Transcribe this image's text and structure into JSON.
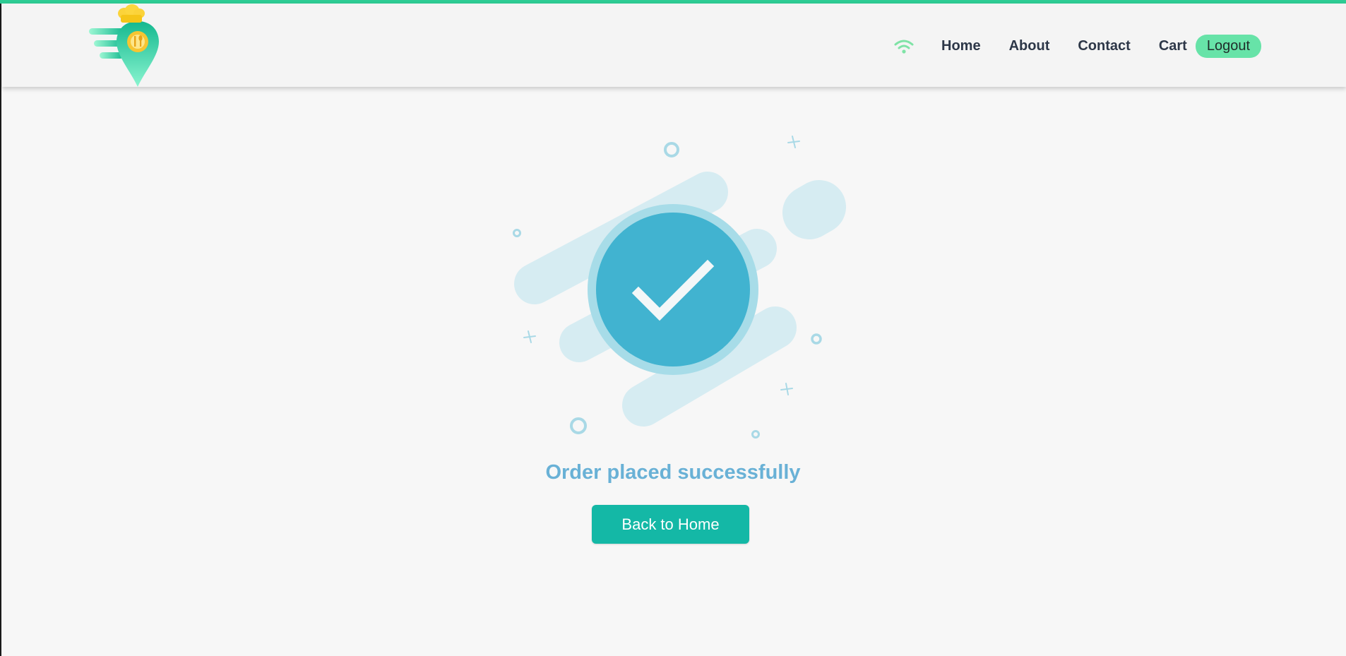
{
  "nav": {
    "links": [
      "Home",
      "About",
      "Contact",
      "Cart"
    ],
    "logout_label": "Logout"
  },
  "success": {
    "message": "Order placed successfully",
    "button_label": "Back to Home"
  },
  "colors": {
    "accent": "#2ecc94",
    "logout_bg": "#67e3a8",
    "button_bg": "#14b8a6",
    "message_text": "#69b1d6",
    "check_circle": "#41b3d0"
  },
  "icons": {
    "logo": "map-pin-chef-logo",
    "connection": "wifi-icon",
    "success": "check-circle-icon"
  }
}
